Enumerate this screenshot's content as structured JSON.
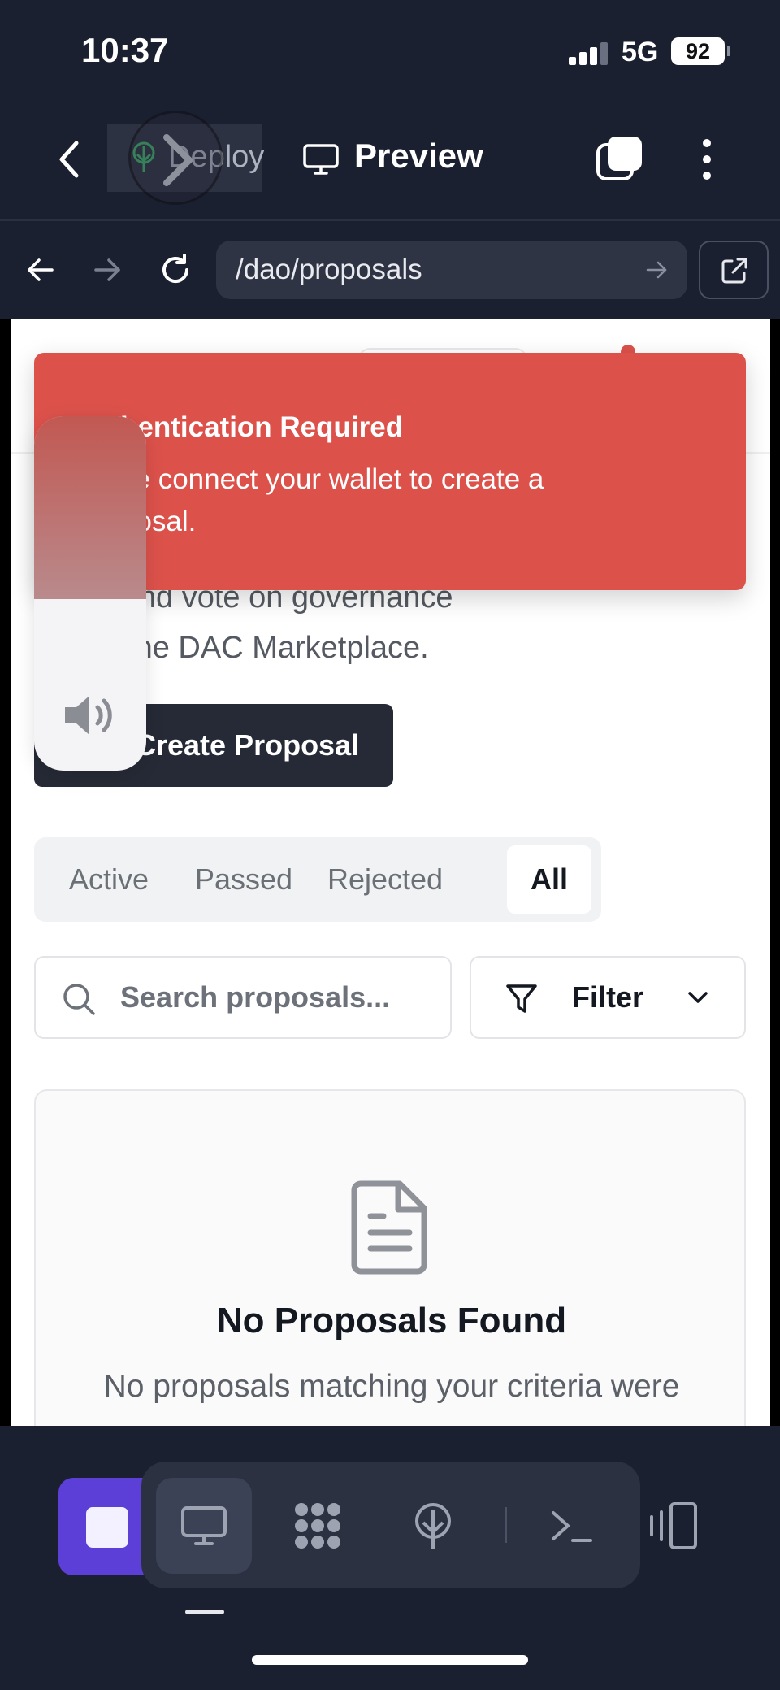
{
  "status_bar": {
    "time": "10:37",
    "network": "5G",
    "battery": "92"
  },
  "header": {
    "deploy_label": "Deploy",
    "preview_label": "Preview"
  },
  "browser": {
    "url": "/dao/proposals"
  },
  "page": {
    "subtitle_line1": "reate, and vote on governance",
    "subtitle_line2": "als for the DAC Marketplace.",
    "create_button": "Create Proposal",
    "tabs": [
      "Active",
      "Passed",
      "Rejected",
      "All"
    ],
    "active_tab": "All",
    "search_placeholder": "Search proposals...",
    "filter_label": "Filter",
    "empty_title": "No Proposals Found",
    "empty_text": "No proposals matching your criteria were"
  },
  "toast": {
    "title": "hentication Required",
    "message_line1": "se connect your wallet to create a",
    "message_line2": "posal.",
    "color": "#dc524b"
  },
  "volume": {
    "level": 0.5
  },
  "dock": {
    "accent": "#5b3fd6"
  }
}
